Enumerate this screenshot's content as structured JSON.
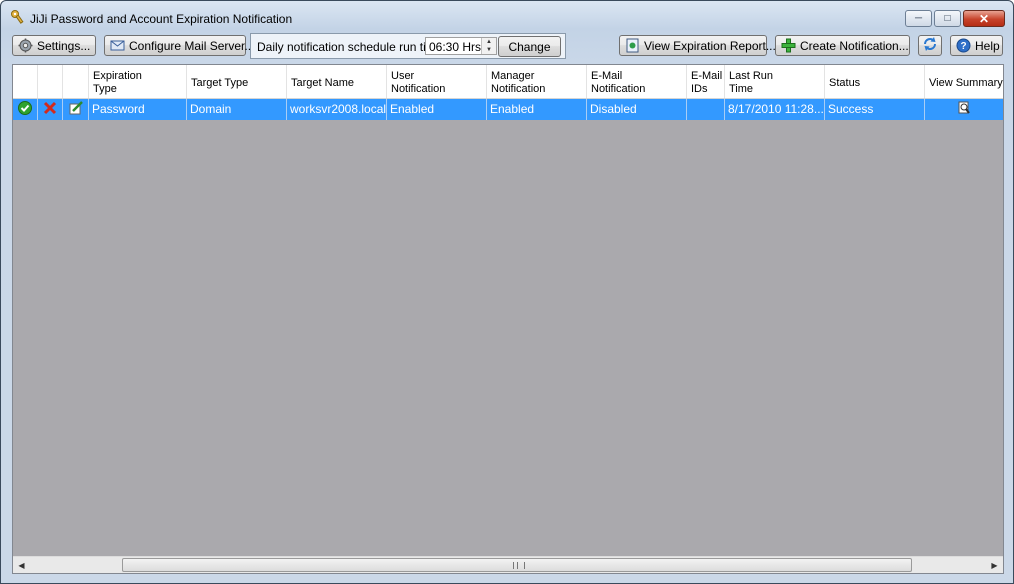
{
  "window": {
    "title": "JiJi Password and Account Expiration Notification"
  },
  "toolbar": {
    "settings_label": "Settings...",
    "mail_label": "Configure Mail Server...",
    "schedule_label": "Daily notification schedule run time:",
    "schedule_time": "06:30 Hrs",
    "change_label": "Change",
    "report_label": "View Expiration Report...",
    "create_label": "Create Notification...",
    "help_label": "Help"
  },
  "grid": {
    "columns": [
      [
        "Expiration",
        "Type"
      ],
      [
        "Target Type",
        ""
      ],
      [
        "Target Name",
        ""
      ],
      [
        "User",
        "Notification"
      ],
      [
        "Manager",
        "Notification"
      ],
      [
        "E-Mail",
        "Notification"
      ],
      [
        "E-Mail",
        "IDs"
      ],
      [
        "Last Run",
        "Time"
      ],
      [
        "Status",
        ""
      ],
      [
        "View Summary",
        ""
      ]
    ],
    "rows": [
      {
        "expiration_type": "Password",
        "target_type": "Domain",
        "target_name": "worksvr2008.local",
        "user_notification": "Enabled",
        "manager_notification": "Enabled",
        "email_notification": "Disabled",
        "email_ids": "",
        "last_run_time": "8/17/2010 11:28...",
        "status": "Success"
      }
    ]
  },
  "colors": {
    "selection": "#3399ff",
    "empty_area": "#aaa9ad"
  },
  "icons": [
    "keys-icon",
    "gear-icon",
    "mail-server-icon",
    "report-icon",
    "add-icon",
    "refresh-icon",
    "help-icon",
    "enable-icon",
    "delete-icon",
    "edit-icon",
    "magnifier-icon"
  ]
}
